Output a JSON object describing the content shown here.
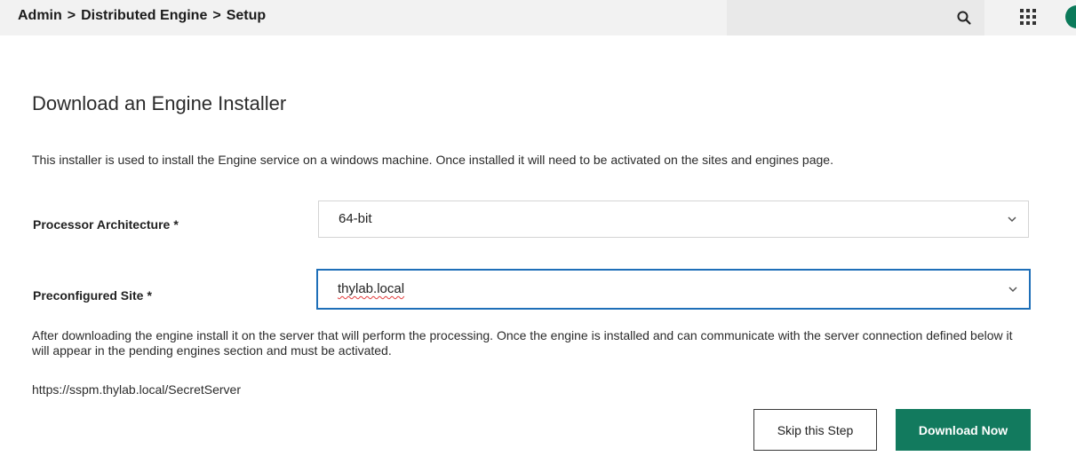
{
  "header": {
    "breadcrumb": [
      "Admin",
      "Distributed Engine",
      "Setup"
    ],
    "breadcrumb_separator": ">",
    "search_placeholder": "",
    "search_icon": "search-icon",
    "apps_icon": "apps-grid-icon",
    "avatar_color": "#0b7a5a"
  },
  "main": {
    "title": "Download an Engine Installer",
    "description": "This installer is used to install the Engine service on a windows machine. Once installed it will need to be activated on the sites and engines page.",
    "processor_architecture": {
      "label": "Processor Architecture",
      "required_mark": "*",
      "selected": "64-bit"
    },
    "preconfigured_site": {
      "label": "Preconfigured Site",
      "required_mark": "*",
      "selected": "thylab.local"
    },
    "info_text": "After downloading the engine install it on the server that will perform the processing. Once the engine is installed and can communicate with the server connection defined below it will appear in the pending engines section and must be activated.",
    "server_url": "https://sspm.thylab.local/SecretServer"
  },
  "actions": {
    "skip_label": "Skip this Step",
    "download_label": "Download Now"
  },
  "colors": {
    "primary_button": "#127a5e",
    "focus_border": "#1e6fb8",
    "header_background": "#f2f2f2"
  }
}
